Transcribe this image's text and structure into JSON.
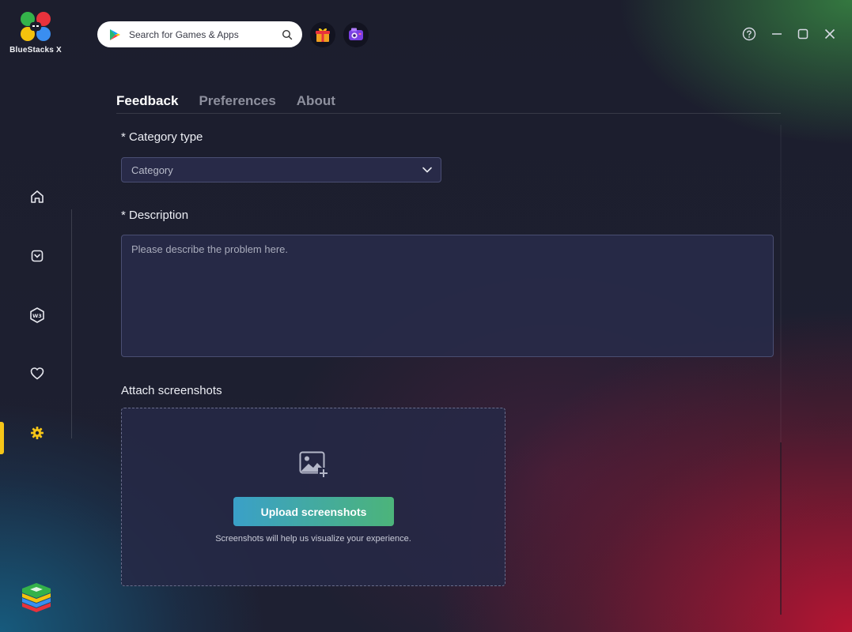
{
  "app": {
    "name": "BlueStacks X"
  },
  "search": {
    "placeholder": "Search for Games & Apps"
  },
  "tabs": [
    {
      "label": "Feedback",
      "active": true
    },
    {
      "label": "Preferences",
      "active": false
    },
    {
      "label": "About",
      "active": false
    }
  ],
  "form": {
    "category_label": "* Category type",
    "category_value": "Category",
    "description_label": "* Description",
    "description_placeholder": "Please describe the problem here.",
    "attach_label": "Attach screenshots",
    "upload_button": "Upload screenshots",
    "upload_hint": "Screenshots will help us visualize your experience."
  },
  "sidebar": {
    "items": [
      {
        "icon": "home-icon"
      },
      {
        "icon": "store-bag-icon"
      },
      {
        "icon": "w3-icon"
      },
      {
        "icon": "heart-icon"
      },
      {
        "icon": "gear-icon",
        "active": true
      }
    ]
  },
  "colors": {
    "accent_active": "#f5c518",
    "upload_gradient_start": "#3aa0c8",
    "upload_gradient_end": "#4cb47a"
  }
}
